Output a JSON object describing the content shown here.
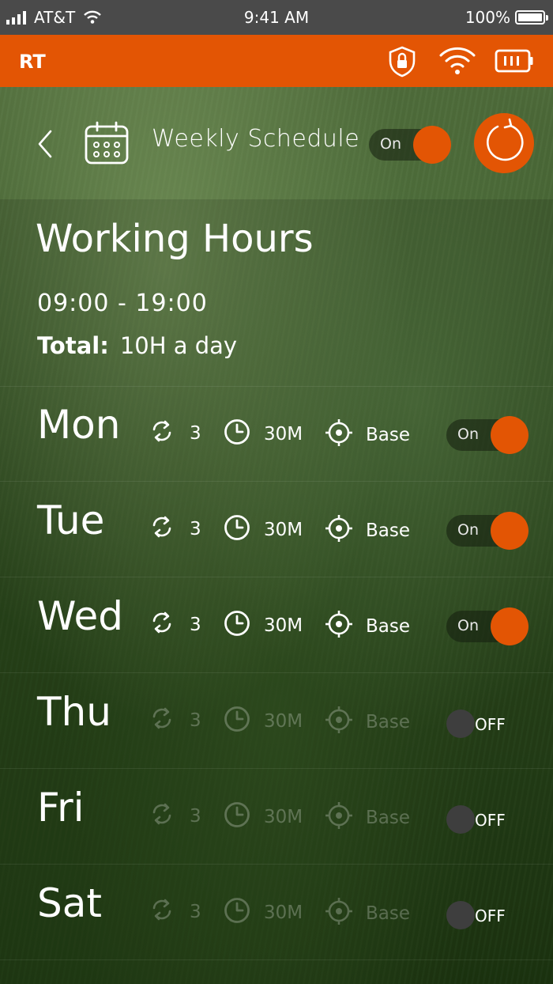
{
  "status_bar": {
    "carrier": "AT&T",
    "time": "9:41 AM",
    "battery": "100%"
  },
  "app_bar": {
    "title": "RT",
    "icons": [
      "shield-lock-icon",
      "wifi-icon",
      "battery-icon"
    ]
  },
  "header": {
    "title": "Weekly Schedule",
    "toggle_label": "On",
    "toggle_state": "on"
  },
  "working_hours": {
    "title": "Working Hours",
    "time_range": "09:00 - 19:00",
    "total_label": "Total:",
    "total_value": "10H a day"
  },
  "days": [
    {
      "name": "Mon",
      "repeat": "3",
      "duration": "30M",
      "location": "Base",
      "toggle_label": "On",
      "enabled": true
    },
    {
      "name": "Tue",
      "repeat": "3",
      "duration": "30M",
      "location": "Base",
      "toggle_label": "On",
      "enabled": true
    },
    {
      "name": "Wed",
      "repeat": "3",
      "duration": "30M",
      "location": "Base",
      "toggle_label": "On",
      "enabled": true
    },
    {
      "name": "Thu",
      "repeat": "3",
      "duration": "30M",
      "location": "Base",
      "toggle_label": "OFF",
      "enabled": false
    },
    {
      "name": "Fri",
      "repeat": "3",
      "duration": "30M",
      "location": "Base",
      "toggle_label": "OFF",
      "enabled": false
    },
    {
      "name": "Sat",
      "repeat": "3",
      "duration": "30M",
      "location": "Base",
      "toggle_label": "OFF",
      "enabled": false
    }
  ],
  "colors": {
    "accent": "#e35504",
    "status_bar": "#4a4a4a",
    "toggle_off_knob": "#3e3e3e"
  }
}
